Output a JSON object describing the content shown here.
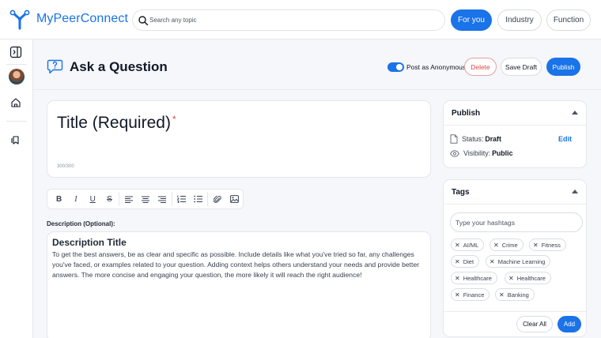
{
  "app": {
    "brand": "MyPeerConnect"
  },
  "search": {
    "placeholder": "Search any topic"
  },
  "nav": {
    "for_you": "For you",
    "industry": "Industry",
    "function": "Function"
  },
  "page": {
    "title": "Ask a Question",
    "anonymous_label": "Post as Anonymous",
    "anonymous_enabled": true,
    "delete_label": "Delete",
    "save_draft_label": "Save Draft",
    "publish_label": "Publish"
  },
  "editor": {
    "title_placeholder": "Title (Required)",
    "required_mark": "*",
    "char_counter": "300/300",
    "description_label": "Description (Optional):",
    "description_title": "Description Title",
    "description_body": "To get the best answers, be as clear and specific as possible. Include details like what you've tried so far, any challenges you've faced, or examples related to your question. Adding context helps others understand your needs and provide better answers. The more concise and engaging your question, the more likely it will reach the right audience!",
    "toolbar": {
      "bold": "B",
      "italic": "I",
      "underline": "U",
      "strike": "S"
    }
  },
  "publish_panel": {
    "header": "Publish",
    "status_label": "Status:",
    "status_value": "Draft",
    "edit_label": "Edit",
    "visibility_label": "Visibility:",
    "visibility_value": "Public"
  },
  "tags_panel": {
    "header": "Tags",
    "placeholder": "Type your hashtags",
    "tags": [
      "AI/ML",
      "Crime",
      "Fitness",
      "Diet",
      "Machine Learning",
      "Healthcare",
      "Healthcare",
      "Finance",
      "Banking"
    ],
    "clear_label": "Clear All",
    "add_label": "Add"
  },
  "colors": {
    "accent": "#1a73e8",
    "danger": "#e04848"
  }
}
